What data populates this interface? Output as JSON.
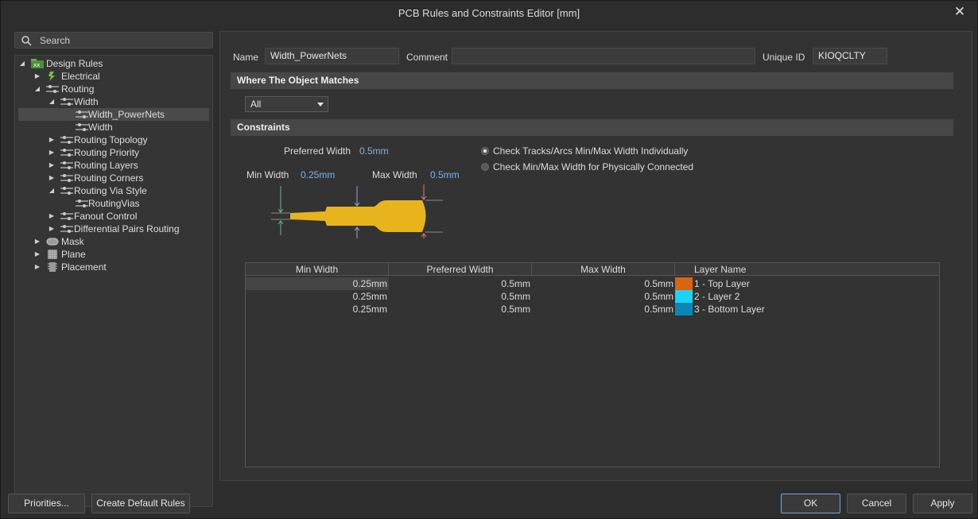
{
  "window": {
    "title": "PCB Rules and Constraints Editor [mm]"
  },
  "search": {
    "placeholder": "Search"
  },
  "tree": [
    {
      "label": "Design Rules",
      "expanded": true
    },
    {
      "label": "Electrical"
    },
    {
      "label": "Routing",
      "expanded": true
    },
    {
      "label": "Width",
      "expanded": true
    },
    {
      "label": "Width_PowerNets",
      "selected": true
    },
    {
      "label": "Width"
    },
    {
      "label": "Routing Topology"
    },
    {
      "label": "Routing Priority"
    },
    {
      "label": "Routing Layers"
    },
    {
      "label": "Routing Corners"
    },
    {
      "label": "Routing Via Style",
      "expanded": true
    },
    {
      "label": "RoutingVias"
    },
    {
      "label": "Fanout Control"
    },
    {
      "label": "Differential Pairs Routing"
    },
    {
      "label": "Mask"
    },
    {
      "label": "Plane"
    },
    {
      "label": "Placement"
    }
  ],
  "rule": {
    "name_label": "Name",
    "name_value": "Width_PowerNets",
    "comment_label": "Comment",
    "comment_value": "",
    "uid_label": "Unique ID",
    "uid_value": "KIOQCLTY"
  },
  "where": {
    "header": "Where The Object Matches",
    "scope_value": "All"
  },
  "constraints": {
    "header": "Constraints",
    "preferred_label": "Preferred Width",
    "preferred_value": "0.5mm",
    "min_label": "Min Width",
    "min_value": "0.25mm",
    "max_label": "Max Width",
    "max_value": "0.5mm",
    "radio_individual": "Check Tracks/Arcs Min/Max Width Individually",
    "radio_connected": "Check Min/Max Width for Physically Connected",
    "selected_radio": "individual",
    "track_color": "#e8b41e"
  },
  "table": {
    "columns": [
      "Min Width",
      "Preferred Width",
      "Max Width",
      "Layer Name"
    ],
    "rows": [
      {
        "min": "0.25mm",
        "preferred": "0.5mm",
        "max": "0.5mm",
        "layer": "1 - Top Layer",
        "color": "#d9650f"
      },
      {
        "min": "0.25mm",
        "preferred": "0.5mm",
        "max": "0.5mm",
        "layer": "2 - Layer 2",
        "color": "#1ed2f5"
      },
      {
        "min": "0.25mm",
        "preferred": "0.5mm",
        "max": "0.5mm",
        "layer": "3 - Bottom Layer",
        "color": "#0a87b4"
      }
    ]
  },
  "buttons": {
    "priorities": "Priorities...",
    "create_default": "Create Default Rules",
    "ok": "OK",
    "cancel": "Cancel",
    "apply": "Apply"
  }
}
